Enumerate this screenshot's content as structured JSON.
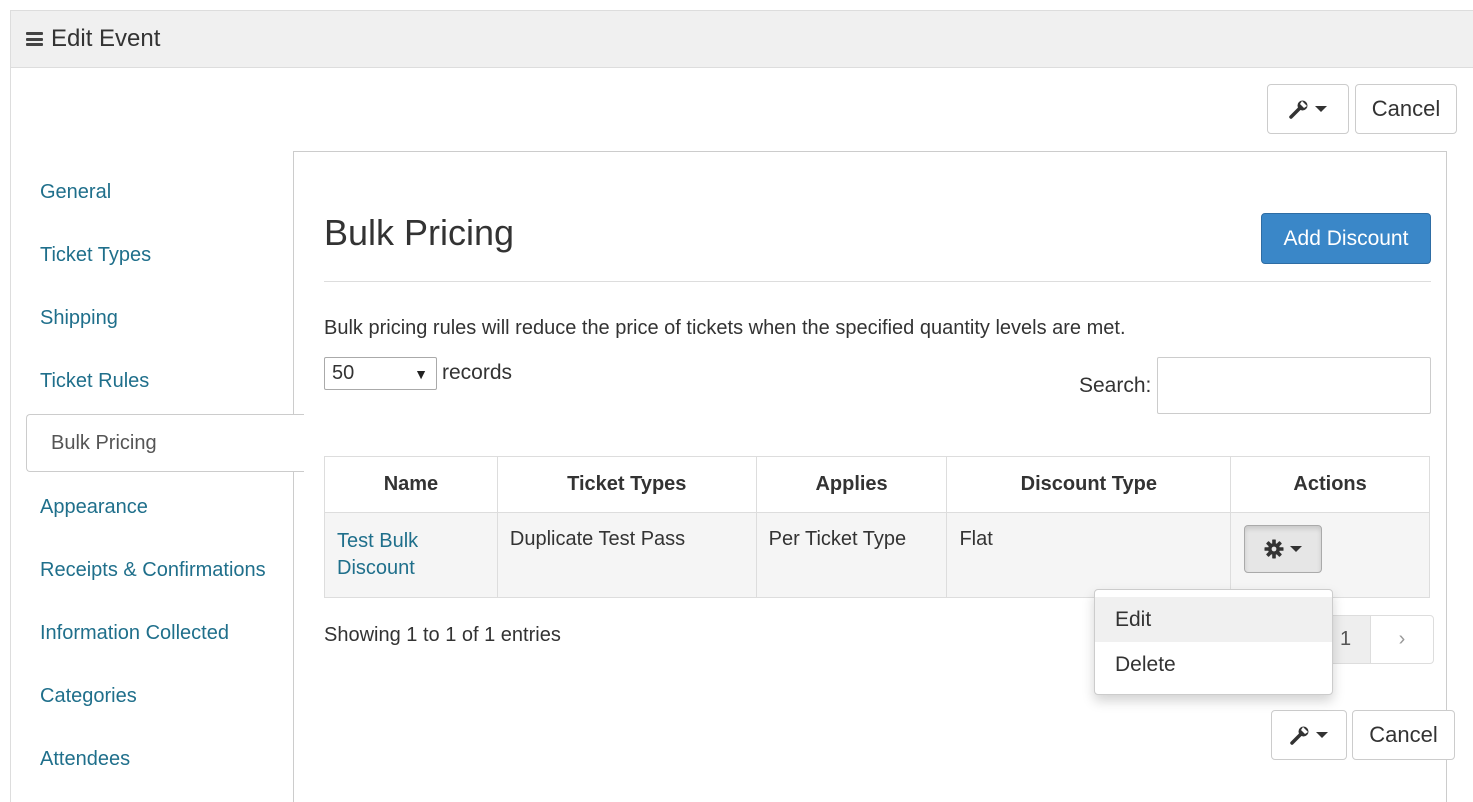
{
  "header": {
    "title": "Edit Event"
  },
  "toolbar": {
    "cancel_label": "Cancel"
  },
  "sidebar": {
    "items": [
      {
        "label": "General"
      },
      {
        "label": "Ticket Types"
      },
      {
        "label": "Shipping"
      },
      {
        "label": "Ticket Rules"
      },
      {
        "label": "Bulk Pricing",
        "active": true
      },
      {
        "label": "Appearance"
      },
      {
        "label": "Receipts & Confirmations"
      },
      {
        "label": "Information Collected"
      },
      {
        "label": "Categories"
      },
      {
        "label": "Attendees"
      }
    ]
  },
  "main": {
    "title": "Bulk Pricing",
    "add_button": "Add Discount",
    "description": "Bulk pricing rules will reduce the price of tickets when the specified quantity levels are met.",
    "length": {
      "value": "50",
      "label": "records"
    },
    "search": {
      "label": "Search:",
      "value": ""
    },
    "table": {
      "columns": [
        "Name",
        "Ticket Types",
        "Applies",
        "Discount Type",
        "Actions"
      ],
      "rows": [
        {
          "name": "Test Bulk Discount",
          "ticket_types": "Duplicate Test Pass",
          "applies": "Per Ticket Type",
          "discount_type": "Flat"
        }
      ]
    },
    "info": "Showing 1 to 1 of 1 entries",
    "pagination": {
      "current": "1",
      "next": "›"
    },
    "actions_menu": [
      "Edit",
      "Delete"
    ]
  },
  "icons": {
    "menu": "hamburger-icon",
    "tools": "wrench-icon",
    "actions": "gear-icon"
  },
  "colors": {
    "link": "#1f6f8b",
    "primary": "#3a87c8",
    "heading_bg": "#f0f0f0"
  }
}
